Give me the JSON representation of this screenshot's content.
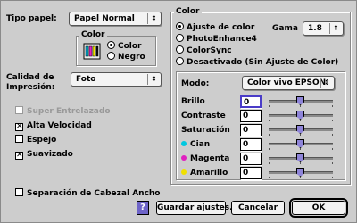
{
  "left": {
    "tipo_papel_label": "Tipo papel:",
    "tipo_papel_value": "Papel Normal",
    "color_group_title": "Color",
    "color_options": [
      "Color",
      "Negro"
    ],
    "calidad_label_1": "Calidad de",
    "calidad_label_2": "Impresión:",
    "calidad_value": "Foto",
    "checkboxes": [
      {
        "label": "Super Entrelazado",
        "checked": false,
        "disabled": true
      },
      {
        "label": "Alta Velocidad",
        "checked": true,
        "disabled": false
      },
      {
        "label": "Espejo",
        "checked": false,
        "disabled": false
      },
      {
        "label": "Suavizado",
        "checked": true,
        "disabled": false
      }
    ],
    "separacion_label": "Separación de Cabezal Ancho"
  },
  "right": {
    "color_group_title": "Color",
    "radios": [
      "Ajuste de color",
      "PhotoEnhance4",
      "ColorSync",
      "Desactivado (Sin Ajuste de Color)"
    ],
    "gama_label": "Gama",
    "gama_value": "1.8",
    "modo_label": "Modo:",
    "modo_value": "Color vivo EPSON",
    "sliders": [
      {
        "label": "Brillo",
        "value": "0",
        "dot": ""
      },
      {
        "label": "Contraste",
        "value": "0",
        "dot": ""
      },
      {
        "label": "Saturación",
        "value": "0",
        "dot": ""
      },
      {
        "label": "Cian",
        "value": "0",
        "dot": "#00c8e0"
      },
      {
        "label": "Magenta",
        "value": "0",
        "dot": "#e020c0"
      },
      {
        "label": "Amarillo",
        "value": "0",
        "dot": "#f0e000"
      }
    ]
  },
  "buttons": {
    "help": "?",
    "guardar": "Guardar ajustes...",
    "cancelar": "Cancelar",
    "ok": "OK"
  },
  "colors": {
    "accent": "#4a3cc8",
    "thumb": "#8e84d8",
    "background": "#cdcdcd"
  }
}
